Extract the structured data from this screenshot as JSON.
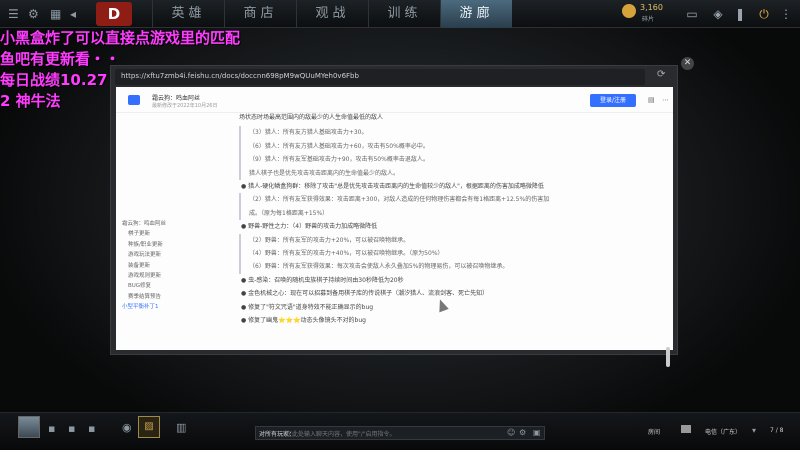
{
  "nav": {
    "tabs": [
      "英雄",
      "商店",
      "观战",
      "训练",
      "游廊"
    ],
    "active_index": 4
  },
  "topbar": {
    "gold_value": "3,160",
    "gold_sub": "碎片"
  },
  "overlay": {
    "lines": [
      "小黑盒炸了可以直接点游戏里的匹配",
      "鱼吧有更新看・・",
      "每日战绩10.27",
      "2 神牛法"
    ]
  },
  "browser": {
    "url": "https://xftu7zmb4i.feishu.cn/docs/doccnn698pM9wQUuMYeh0v6Fbb"
  },
  "doc": {
    "title": "霜云狗：鸣血阿丝",
    "subtitle": "最新修改于2022年10月26日",
    "login_label": "登录/注册",
    "toc": [
      "霜云狗：鸣血阿丝",
      "棋子更新",
      "种族/职业更新",
      "游戏玩法更新",
      "装备更新",
      "游戏规则更新",
      "BUG修复",
      "赛季结算预告",
      "小型平衡补丁1"
    ],
    "content": [
      {
        "type": "text",
        "text": "场状态时场最高范围内的敌最少的人生命值最低的敌人"
      },
      {
        "type": "quote",
        "text": "（3）猎人：所有友方猎人基础攻击力+30。"
      },
      {
        "type": "quote",
        "text": "（6）猎人：所有友方猎人基础攻击力+60，攻击有50%概率必中。"
      },
      {
        "type": "quote",
        "text": "（9）猎人：所有友军基础攻击力+90，攻击有50%概率击退敌人。"
      },
      {
        "type": "quote",
        "text": "猎人棋子也是优先攻击攻击距离内的生命值最少的敌人。"
      },
      {
        "type": "bullet",
        "text": "● 猎人-硬化鳞盒狗群：移除了攻击\"总是优先攻击攻击距离内的生命值较少的敌人\"，根据距离的伤害加成略微降低"
      },
      {
        "type": "quote",
        "text": "（2）猎人：所有友军获得效果：攻击距离+300，对敌人造成的任何物理伤害都会有每1格距离+12.5%的伤害加成。（原为每1格距离+15%）"
      },
      {
        "type": "bullet",
        "text": "● 野兽-野性之力：（4）野兽的攻击力加成略微降低"
      },
      {
        "type": "quote",
        "text": "（2）野兽：所有友军的攻击力+20%，可以被召唤物继承。"
      },
      {
        "type": "quote",
        "text": "（4）野兽：所有友军的攻击力+40%，可以被召唤物继承。（原为50%）"
      },
      {
        "type": "quote",
        "text": "（6）野兽：所有友军获得效果：每次攻击会使敌人永久叠加5%的物理易伤，可以被召唤物继承。"
      },
      {
        "type": "bullet",
        "text": "● 虫-感染：召唤的随机虫族棋子持续时间由30秒降低为20秒"
      },
      {
        "type": "bullet",
        "text": "● 金色机械之心：现在可以招募到备用棋子库的传说棋子（潮汐猎人、流浪剑客、死亡先知）"
      },
      {
        "type": "bullet",
        "text": "● 修复了\"符文咒语\"道身特效不能正确显示的bug"
      },
      {
        "type": "bullet",
        "text": "● 修复了幽鬼⭐⭐⭐动态头像镜头不对的bug"
      }
    ]
  },
  "chat": {
    "label": "对所有玩家：",
    "placeholder": "在此处输入聊天内容，使用\"/\"启用指令。"
  },
  "status": {
    "room_label": "房间",
    "region": "电信（广东）",
    "count": "7 / 8"
  }
}
